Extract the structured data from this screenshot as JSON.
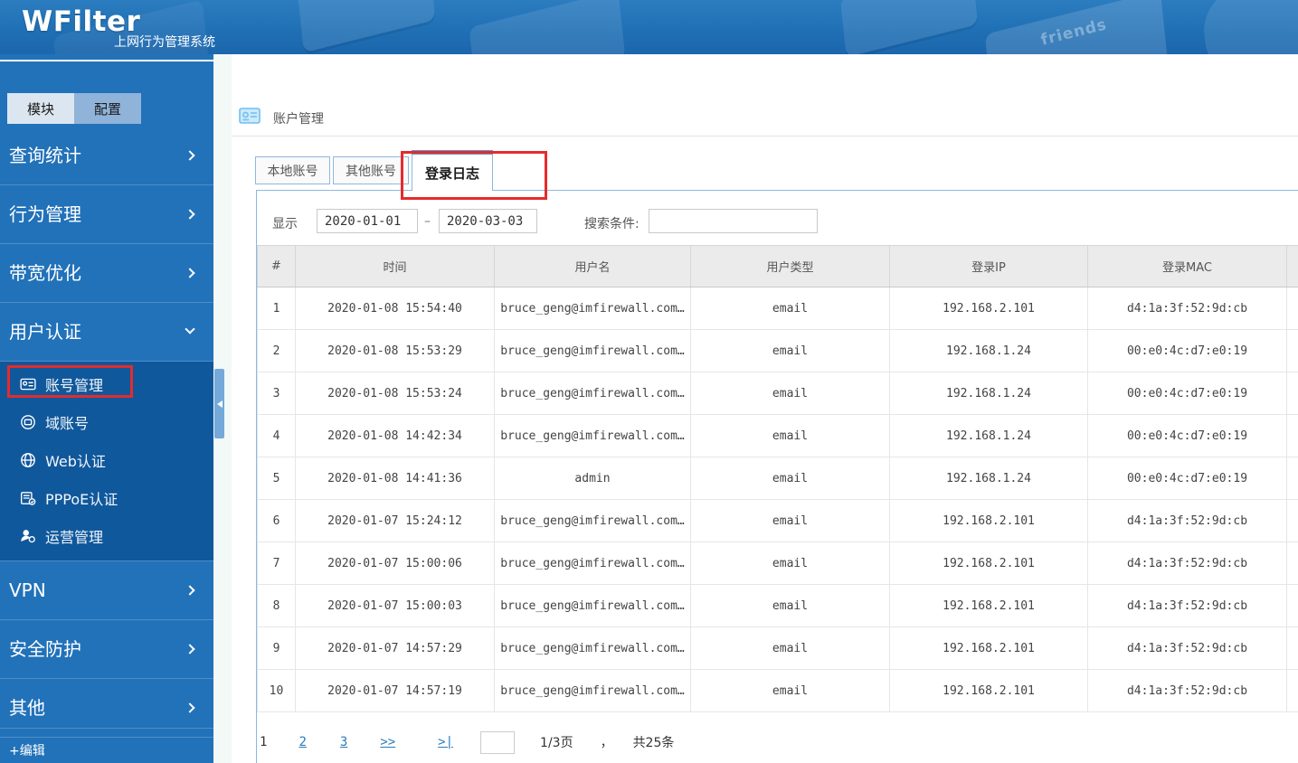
{
  "banner": {
    "logo": "WFilter",
    "subtitle": "上网行为管理系统",
    "key_label": "friends"
  },
  "sidebar": {
    "tabs": [
      {
        "label": "模块"
      },
      {
        "label": "配置"
      }
    ],
    "menu": [
      {
        "label": "查询统计"
      },
      {
        "label": "行为管理"
      },
      {
        "label": "带宽优化"
      },
      {
        "label": "用户认证"
      }
    ],
    "submenu": [
      {
        "label": "账号管理"
      },
      {
        "label": "域账号"
      },
      {
        "label": "Web认证"
      },
      {
        "label": "PPPoE认证"
      },
      {
        "label": "运营管理"
      }
    ],
    "menu2": [
      {
        "label": "VPN"
      },
      {
        "label": "安全防护"
      },
      {
        "label": "其他"
      }
    ],
    "edit_link": "+编辑"
  },
  "page": {
    "title": "账户管理"
  },
  "tabs": [
    {
      "label": "本地账号"
    },
    {
      "label": "其他账号"
    },
    {
      "label": "登录日志"
    }
  ],
  "filters": {
    "show_label": "显示",
    "date_from": "2020-01-01",
    "dash": "–",
    "date_to": "2020-03-03",
    "search_label": "搜索条件:",
    "search_value": ""
  },
  "table": {
    "headers": [
      "#",
      "时间",
      "用户名",
      "用户类型",
      "登录IP",
      "登录MAC"
    ],
    "rows": [
      [
        "1",
        "2020-01-08 15:54:40",
        "bruce_geng@imfirewall.com…",
        "email",
        "192.168.2.101",
        "d4:1a:3f:52:9d:cb"
      ],
      [
        "2",
        "2020-01-08 15:53:29",
        "bruce_geng@imfirewall.com…",
        "email",
        "192.168.1.24",
        "00:e0:4c:d7:e0:19"
      ],
      [
        "3",
        "2020-01-08 15:53:24",
        "bruce_geng@imfirewall.com…",
        "email",
        "192.168.1.24",
        "00:e0:4c:d7:e0:19"
      ],
      [
        "4",
        "2020-01-08 14:42:34",
        "bruce_geng@imfirewall.com…",
        "email",
        "192.168.1.24",
        "00:e0:4c:d7:e0:19"
      ],
      [
        "5",
        "2020-01-08 14:41:36",
        "admin",
        "email",
        "192.168.1.24",
        "00:e0:4c:d7:e0:19"
      ],
      [
        "6",
        "2020-01-07 15:24:12",
        "bruce_geng@imfirewall.com…",
        "email",
        "192.168.2.101",
        "d4:1a:3f:52:9d:cb"
      ],
      [
        "7",
        "2020-01-07 15:00:06",
        "bruce_geng@imfirewall.com…",
        "email",
        "192.168.2.101",
        "d4:1a:3f:52:9d:cb"
      ],
      [
        "8",
        "2020-01-07 15:00:03",
        "bruce_geng@imfirewall.com…",
        "email",
        "192.168.2.101",
        "d4:1a:3f:52:9d:cb"
      ],
      [
        "9",
        "2020-01-07 14:57:29",
        "bruce_geng@imfirewall.com…",
        "email",
        "192.168.2.101",
        "d4:1a:3f:52:9d:cb"
      ],
      [
        "10",
        "2020-01-07 14:57:19",
        "bruce_geng@imfirewall.com…",
        "email",
        "192.168.2.101",
        "d4:1a:3f:52:9d:cb"
      ]
    ]
  },
  "pagination": {
    "current": "1",
    "links": [
      "2",
      "3",
      ">>",
      ">|"
    ],
    "goto_value": "",
    "info_page": "1/3页",
    "comma": "，",
    "info_total": "共25条"
  },
  "colors": {
    "banner_blue": "#2070b5",
    "sidebar_blue": "#2272b9",
    "submenu_blue": "#10589c",
    "accent_tab_bar": "#5b9bd3",
    "link_blue": "#2b7bb9",
    "annotation_red": "#e52b2b"
  }
}
